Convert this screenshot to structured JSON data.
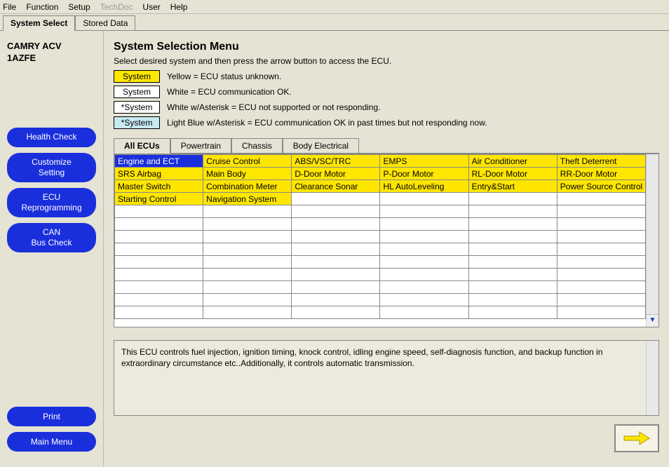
{
  "menubar": {
    "file": "File",
    "function": "Function",
    "setup": "Setup",
    "techdoc": "TechDoc",
    "user": "User",
    "help": "Help"
  },
  "top_tabs": {
    "system_select": "System Select",
    "stored_data": "Stored Data"
  },
  "sidebar": {
    "vehicle_line1": "CAMRY ACV",
    "vehicle_line2": "1AZFE",
    "health_check": "Health Check",
    "customize_setting": "Customize\nSetting",
    "ecu_reprogramming": "ECU\nReprogramming",
    "can_bus_check": "CAN\nBus Check",
    "print": "Print",
    "main_menu": "Main Menu"
  },
  "main": {
    "title": "System Selection Menu",
    "instruction": "Select desired system and then press the arrow button to access the ECU.",
    "legend_yellow_label": "System",
    "legend_yellow_text": "Yellow = ECU status unknown.",
    "legend_white_label": "System",
    "legend_white_text": "White = ECU communication OK.",
    "legend_ast_label": "*System",
    "legend_ast_text": "White w/Asterisk = ECU not supported or not responding.",
    "legend_lb_label": "*System",
    "legend_lb_text": "Light Blue w/Asterisk = ECU communication OK in past times but not responding now."
  },
  "ecu_tabs": {
    "all": "All ECUs",
    "powertrain": "Powertrain",
    "chassis": "Chassis",
    "body": "Body Electrical"
  },
  "grid": {
    "rows": [
      [
        "Engine and ECT",
        "Cruise Control",
        "ABS/VSC/TRC",
        "EMPS",
        "Air Conditioner",
        "Theft Deterrent"
      ],
      [
        "SRS Airbag",
        "Main Body",
        "D-Door Motor",
        "P-Door Motor",
        "RL-Door Motor",
        "RR-Door Motor"
      ],
      [
        "Master Switch",
        "Combination Meter",
        "Clearance Sonar",
        "HL AutoLeveling",
        "Entry&Start",
        "Power Source Control"
      ],
      [
        "Starting Control",
        "Navigation System",
        "",
        "",
        "",
        ""
      ]
    ],
    "selected": [
      0,
      0
    ],
    "empty_row_count": 9
  },
  "description": "This ECU controls fuel injection, ignition timing, knock control, idling engine speed, self-diagnosis function, and backup function in extraordinary circumstance etc..Additionally, it controls automatic transmission."
}
